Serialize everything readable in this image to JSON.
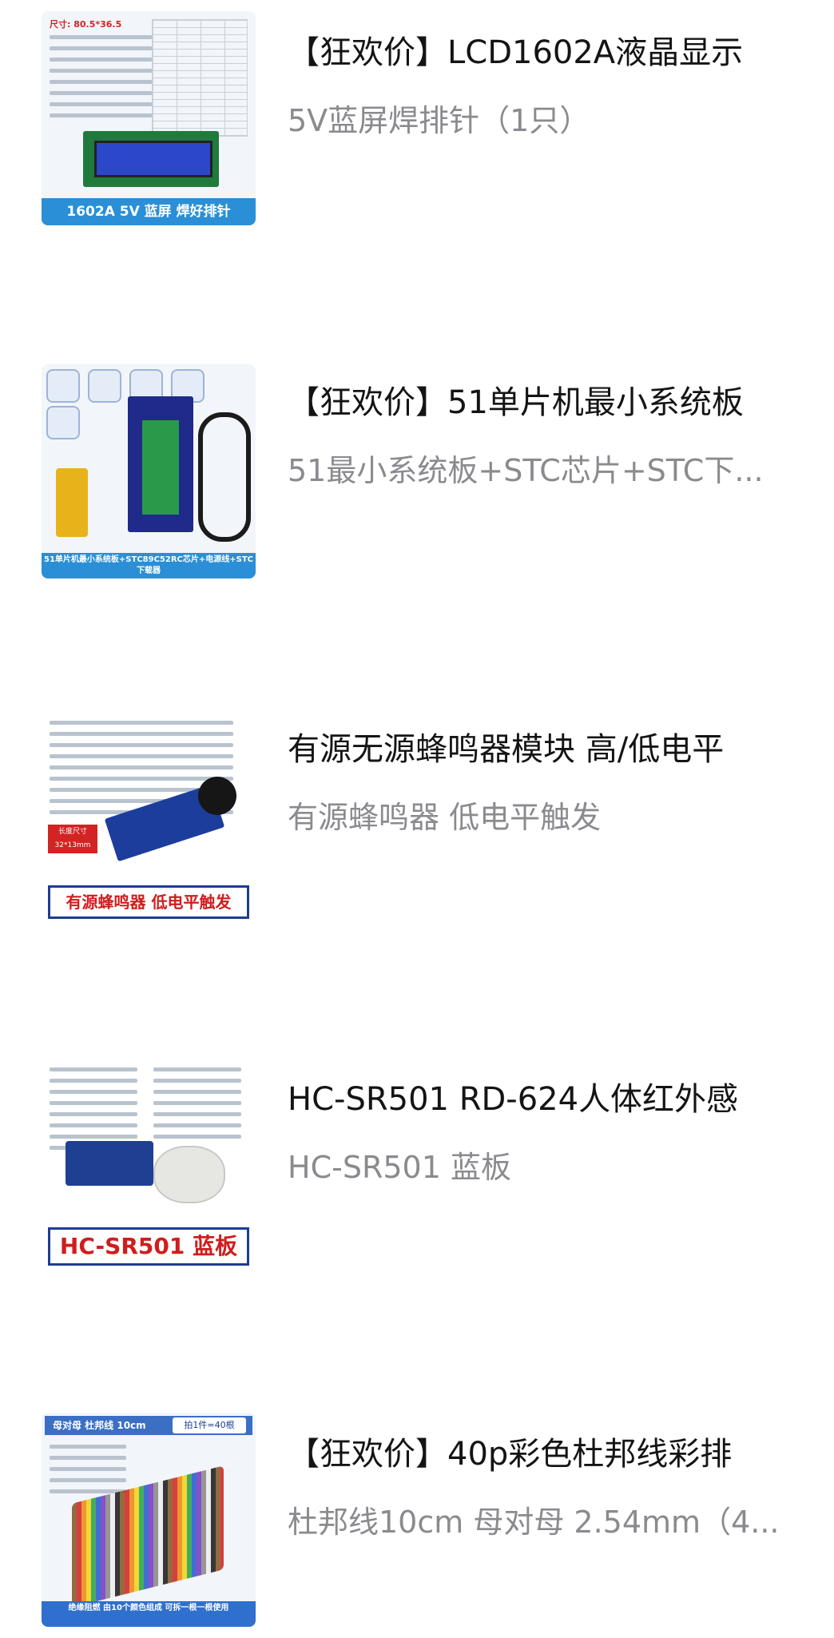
{
  "products": [
    {
      "title": "【狂欢价】LCD1602A液晶显示",
      "subtitle": "5V蓝屏焊排针（1只）",
      "thumb_caption": "1602A 5V 蓝屏 焊好排针",
      "thumb_label": "尺寸: 80.5*36.5"
    },
    {
      "title": "【狂欢价】51单片机最小系统板",
      "subtitle": "51最小系统板+STC芯片+STC下...",
      "thumb_caption": "51单片机最小系统板+STC89C52RC芯片+电源线+STC下载器"
    },
    {
      "title": "有源无源蜂鸣器模块 高/低电平",
      "subtitle": "有源蜂鸣器 低电平触发",
      "thumb_caption": "有源蜂鸣器 低电平触发",
      "thumb_tag_top": "长度尺寸",
      "thumb_tag_bottom": "32*13mm"
    },
    {
      "title": "HC-SR501 RD-624人体红外感",
      "subtitle": "HC-SR501 蓝板",
      "thumb_caption": "HC-SR501 蓝板"
    },
    {
      "title": "【狂欢价】40p彩色杜邦线彩排",
      "subtitle": "杜邦线10cm 母对母 2.54mm（4...",
      "thumb_header": "母对母 杜邦线 10cm",
      "thumb_header_tag": "拍1件=40根",
      "thumb_caption": "绝缘阻燃 由10个颜色组成 可拆一根一根使用"
    }
  ]
}
